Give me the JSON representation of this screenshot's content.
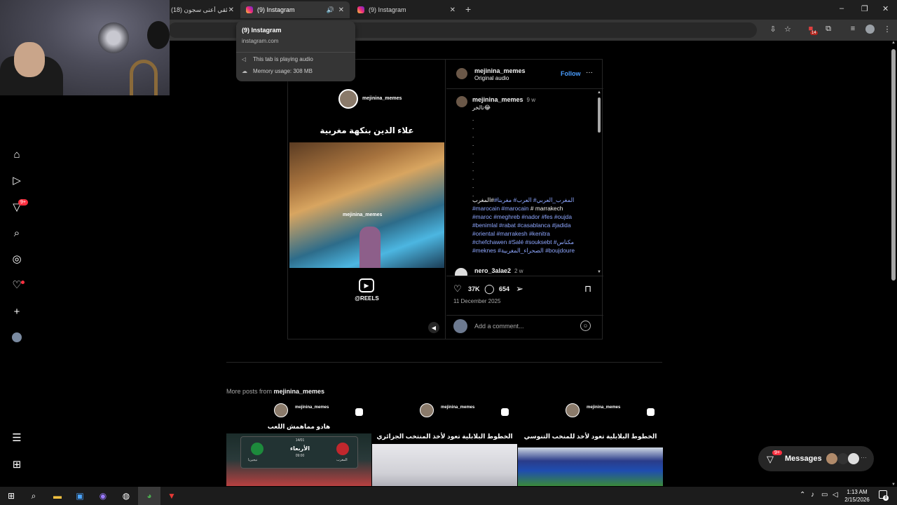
{
  "browser": {
    "tabs": [
      {
        "title": "(18) وثائقي أعنى سجون"
      },
      {
        "title": "(9) Instagram"
      },
      {
        "title": "(9) Instagram"
      }
    ],
    "new_tab": "+",
    "window_controls": {
      "minimize": "–",
      "restore": "❐",
      "close": "✕"
    }
  },
  "hover_card": {
    "title": "(9) Instagram",
    "domain": "instagram.com",
    "audio": "This tab is playing audio",
    "memory": "Memory usage: 308 MB"
  },
  "toolbar": {
    "extension_badge": "14"
  },
  "nav": {
    "notifications_badge": "9+"
  },
  "post": {
    "media": {
      "handle": "mejinina_memes",
      "title": "علاء الدين بنكهة مغربية",
      "image_handle": "mejinina_memes",
      "reels_label": "@REELS"
    },
    "author": "mejinina_memes",
    "audio": "Original audio",
    "follow": "Follow",
    "more": "···",
    "caption": {
      "author": "mejinina_memes",
      "time": "9 w",
      "text": "تالخر😂",
      "dots": [
        ".",
        ".",
        ".",
        ".",
        ".",
        ".",
        ".",
        ".",
        ".",
        "."
      ],
      "tags_lines": [
        {
          "blue": "المغرب_العربي# العرب# مغربنا#",
          "white": "#المغرب"
        },
        {
          "blue": "#marocain #marocain",
          "white": " # marrakech"
        },
        {
          "blue": "#maroc #meghreb #nador #fes #oujda",
          "white": ""
        },
        {
          "blue": "#benimlal #rabat #casablanca #jadida",
          "white": ""
        },
        {
          "blue": "#oriental #marrakesh #kenitra",
          "white": ""
        },
        {
          "blue": "#chefchawen #Salé #souksebt #مكناس",
          "white": ""
        },
        {
          "blue": "#meknes #الصحراء_المغربية #boujdoure",
          "white": ""
        }
      ]
    },
    "next_comment": {
      "author": "nero_3alae2",
      "time": "2 w"
    },
    "likes": "37K",
    "comments": "654",
    "date": "11 December 2025",
    "add_comment_placeholder": "Add a comment..."
  },
  "more_posts": {
    "prefix": "More posts from ",
    "author": "mejinina_memes",
    "items": [
      {
        "handle": "mejinina_memes",
        "title": "هادو مماهمش اللعب",
        "date": "14/01",
        "day": "الأربعاء",
        "time": "09:00",
        "team_left": "المغرب",
        "team_right": "نيجيريا"
      },
      {
        "handle": "mejinina_memes",
        "title": "الخطوط البلابلية تعود لأخذ المنتخب الجزائري"
      },
      {
        "handle": "mejinina_memes",
        "title": "الخطوط البلابلية تعود لأخذ للمنخب التنوسي"
      }
    ]
  },
  "messages": {
    "label": "Messages",
    "badge": "9+",
    "more": "···"
  },
  "taskbar": {
    "time": "1:13 AM",
    "date": "2/15/2026",
    "notif_count": "8"
  },
  "colors": {
    "accent": "#4a9eff",
    "hashtag": "#8ea7ff",
    "badge": "#ff3040",
    "bg": "#000000"
  }
}
